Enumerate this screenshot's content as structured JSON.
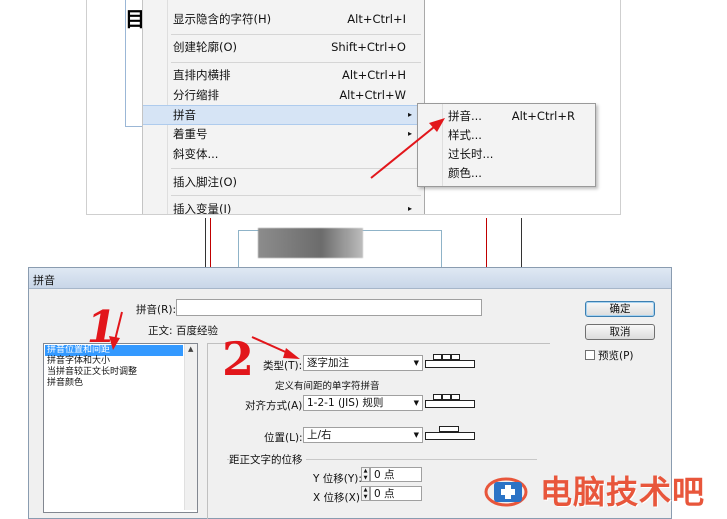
{
  "top_menu": {
    "items": [
      {
        "label": "显示隐含的字符(H)",
        "shortcut": "Alt+Ctrl+I",
        "submenu": false
      },
      {
        "label": "创建轮廓(O)",
        "shortcut": "Shift+Ctrl+O",
        "submenu": false
      },
      {
        "label": "直排内横排",
        "shortcut": "Alt+Ctrl+H",
        "submenu": false
      },
      {
        "label": "分行缩排",
        "shortcut": "Alt+Ctrl+W",
        "submenu": false
      },
      {
        "label": "拼音",
        "shortcut": "",
        "submenu": true,
        "highlighted": true
      },
      {
        "label": "着重号",
        "shortcut": "",
        "submenu": true
      },
      {
        "label": "斜变体...",
        "shortcut": "",
        "submenu": false
      },
      {
        "label": "插入脚注(O)",
        "shortcut": "",
        "submenu": false
      },
      {
        "label": "插入变量(I)",
        "shortcut": "",
        "submenu": true
      }
    ],
    "submenu_arrow": "▸"
  },
  "sub_menu": {
    "items": [
      {
        "label": "拼音...",
        "shortcut": "Alt+Ctrl+R"
      },
      {
        "label": "样式...",
        "shortcut": ""
      },
      {
        "label": "过长时...",
        "shortcut": ""
      },
      {
        "label": "颜色...",
        "shortcut": ""
      }
    ]
  },
  "dialog": {
    "title": "拼音",
    "pinyin_label": "拼音(R):",
    "pinyin_value": "",
    "body_text_label": "正文:",
    "body_text_value": "百度经验",
    "ok_button": "确定",
    "cancel_button": "取消",
    "preview_label": "预览(P)",
    "categories": [
      {
        "label": "拼音位置和间距",
        "selected": true
      },
      {
        "label": "拼音字体和大小",
        "selected": false
      },
      {
        "label": "当拼音较正文长时调整",
        "selected": false
      },
      {
        "label": "拼音颜色",
        "selected": false
      }
    ],
    "type_label": "类型(T):",
    "type_value": "逐字加注",
    "type_note": "定义有间距的单字符拼音",
    "align_label": "对齐方式(A):",
    "align_value": "1-2-1 (JIS) 规则",
    "position_label": "位置(L):",
    "position_value": "上/右",
    "offset_group_label": "距正文字的位移",
    "y_offset_label": "Y 位移(Y):",
    "y_offset_value": "0 点",
    "x_offset_label": "X 位移(X):",
    "x_offset_value": "0 点"
  },
  "annotations": {
    "step1": "1",
    "step2": "2",
    "arrow_color": "#e2161b"
  },
  "watermark": {
    "text": "电脑技术吧",
    "color": "#e8563b"
  }
}
